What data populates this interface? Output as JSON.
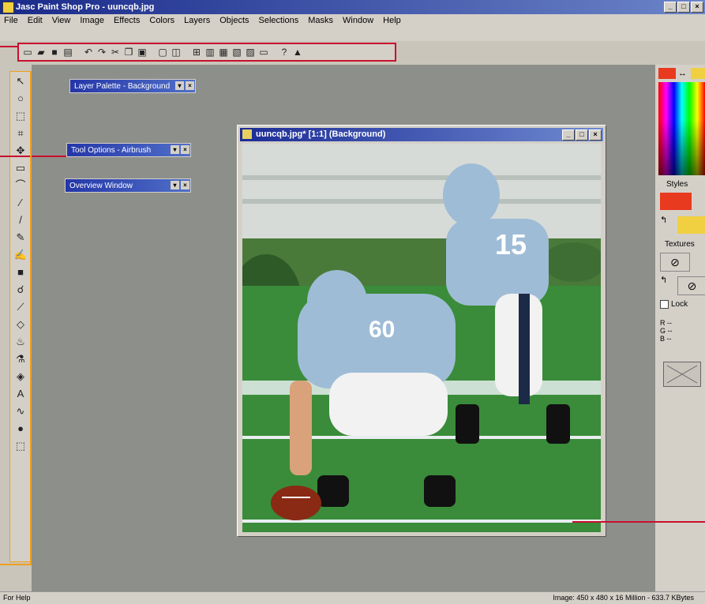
{
  "app": {
    "title": "Jasc Paint Shop Pro - uuncqb.jpg"
  },
  "menu": [
    "File",
    "Edit",
    "View",
    "Image",
    "Effects",
    "Colors",
    "Layers",
    "Objects",
    "Selections",
    "Masks",
    "Window",
    "Help"
  ],
  "toolbar": {
    "icons": [
      "new-icon",
      "open-icon",
      "save-icon",
      "print-icon",
      "undo-icon",
      "redo-icon",
      "cut-icon",
      "copy-icon",
      "paste-icon",
      "browse-icon",
      "full-screen-icon",
      "grid-icon",
      "histogram-icon",
      "color-palette-icon",
      "overview-icon",
      "layer-icon",
      "tool-options-icon",
      "help-icon",
      "lock-icon"
    ]
  },
  "palettes": {
    "layer": {
      "label": "Layer Palette - Background"
    },
    "tool_options": {
      "label": "Tool Options - Airbrush"
    },
    "overview": {
      "label": "Overview Window"
    }
  },
  "image_window": {
    "title": "uuncqb.jpg* [1:1] (Background)"
  },
  "photo": {
    "jersey_a": "60",
    "jersey_b": "15"
  },
  "right_panel": {
    "styles": "Styles",
    "textures": "Textures",
    "lock": "Lock",
    "r": "R --",
    "g": "G --",
    "b": "B --"
  },
  "status": {
    "left": "For Help",
    "right": "Image: 450 x 480 x 16 Million - 633.7 KBytes"
  },
  "colors": {
    "accent": "#c8102e",
    "title_blue": "#1a2a8a",
    "foreground": "#e83a1e",
    "background": "#f0d040"
  }
}
